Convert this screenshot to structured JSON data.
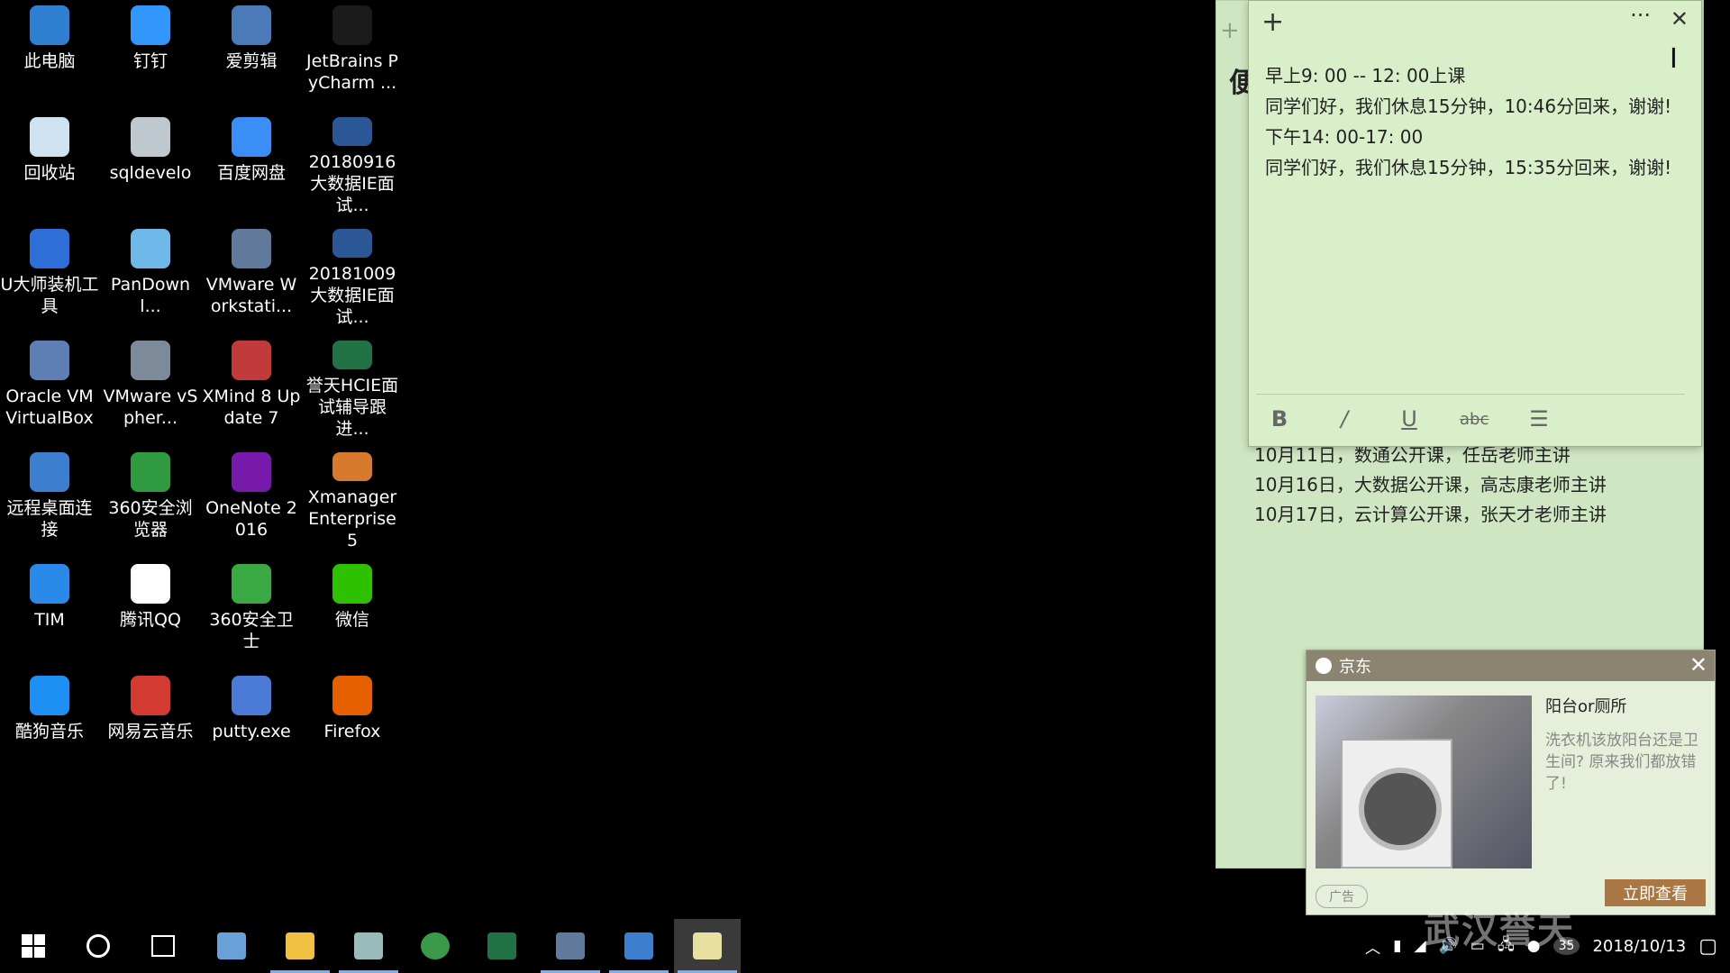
{
  "desktop_icons": [
    {
      "label": "此电脑",
      "icon": "computer-icon",
      "color": "#2f7fd3"
    },
    {
      "label": "钉钉",
      "icon": "dingtalk-icon",
      "color": "#3296fa"
    },
    {
      "label": "爱剪辑",
      "icon": "video-editor-icon",
      "color": "#4a7ab8"
    },
    {
      "label": "JetBrains PyCharm ...",
      "icon": "pycharm-icon",
      "color": "#1a1a1a"
    },
    {
      "label": "回收站",
      "icon": "recycle-bin-icon",
      "color": "#cfe2f2"
    },
    {
      "label": "sqldevelo",
      "icon": "sqldeveloper-icon",
      "color": "#bfc7cf"
    },
    {
      "label": "百度网盘",
      "icon": "baidu-netdisk-icon",
      "color": "#3a8ef6"
    },
    {
      "label": "20180916大数据IE面试...",
      "icon": "word-doc-icon",
      "color": "#2b5797"
    },
    {
      "label": "U大师装机工具",
      "icon": "udashi-icon",
      "color": "#2d6fd6"
    },
    {
      "label": "PanDownl...",
      "icon": "pandownload-icon",
      "color": "#6fb8ea"
    },
    {
      "label": "VMware Workstati...",
      "icon": "vmware-icon",
      "color": "#617a9c"
    },
    {
      "label": "20181009大数据IE面试...",
      "icon": "word-doc-icon",
      "color": "#2b5797"
    },
    {
      "label": "Oracle VM VirtualBox",
      "icon": "virtualbox-icon",
      "color": "#5d7fb3"
    },
    {
      "label": "VMware vSpher...",
      "icon": "vsphere-icon",
      "color": "#7c8a99"
    },
    {
      "label": "XMind 8 Update 7",
      "icon": "xmind-icon",
      "color": "#c23b3b"
    },
    {
      "label": "誉天HCIE面试辅导跟进...",
      "icon": "excel-doc-icon",
      "color": "#217346"
    },
    {
      "label": "远程桌面连接",
      "icon": "remote-desktop-icon",
      "color": "#3c7fcf"
    },
    {
      "label": "360安全浏览器",
      "icon": "360-browser-icon",
      "color": "#2f9a3f"
    },
    {
      "label": "OneNote 2016",
      "icon": "onenote-icon",
      "color": "#7719aa"
    },
    {
      "label": "Xmanager Enterprise 5",
      "icon": "xmanager-icon",
      "color": "#d77a2e"
    },
    {
      "label": "TIM",
      "icon": "tim-icon",
      "color": "#2a8ae9"
    },
    {
      "label": "腾讯QQ",
      "icon": "qq-icon",
      "color": "#ffffff"
    },
    {
      "label": "360安全卫士",
      "icon": "360-safe-icon",
      "color": "#3aa843"
    },
    {
      "label": "微信",
      "icon": "wechat-icon",
      "color": "#2dc100"
    },
    {
      "label": "酷狗音乐",
      "icon": "kugou-icon",
      "color": "#1e8ff5"
    },
    {
      "label": "网易云音乐",
      "icon": "netease-music-icon",
      "color": "#d33a31"
    },
    {
      "label": "putty.exe",
      "icon": "putty-icon",
      "color": "#4b7bd6"
    },
    {
      "label": "Firefox",
      "icon": "firefox-icon",
      "color": "#e66000"
    }
  ],
  "sticky_back": {
    "title_char": "便",
    "lines": [
      "10月11日，数通公开课，任岳老师主讲",
      "10月16日，大数据公开课，高志康老师主讲",
      "10月17日，云计算公开课，张天才老师主讲"
    ]
  },
  "sticky_front": {
    "add_label": "+",
    "more_label": "···",
    "close_label": "✕",
    "lines": [
      "早上9: 00 -- 12: 00上课",
      "同学们好，我们休息15分钟，10:46分回来，谢谢!",
      "下午14: 00-17: 00",
      "同学们好，我们休息15分钟，15:35分回来，谢谢!"
    ],
    "format_buttons": [
      {
        "label": "B",
        "name": "bold-button"
      },
      {
        "label": "/",
        "name": "italic-button"
      },
      {
        "label": "U",
        "name": "underline-button"
      },
      {
        "label": "abc",
        "name": "strikethrough-button"
      },
      {
        "label": "☰",
        "name": "list-button"
      }
    ]
  },
  "popup": {
    "source": "京东",
    "close_label": "✕",
    "title": "阳台or厕所",
    "description": "洗衣机该放阳台还是卫生间? 原来我们都放错了!",
    "ad_label": "广告",
    "view_label": "立即查看"
  },
  "taskbar": {
    "clock_date": "2018/10/13",
    "notification_count": "35",
    "watermark": "武汉誉天"
  }
}
